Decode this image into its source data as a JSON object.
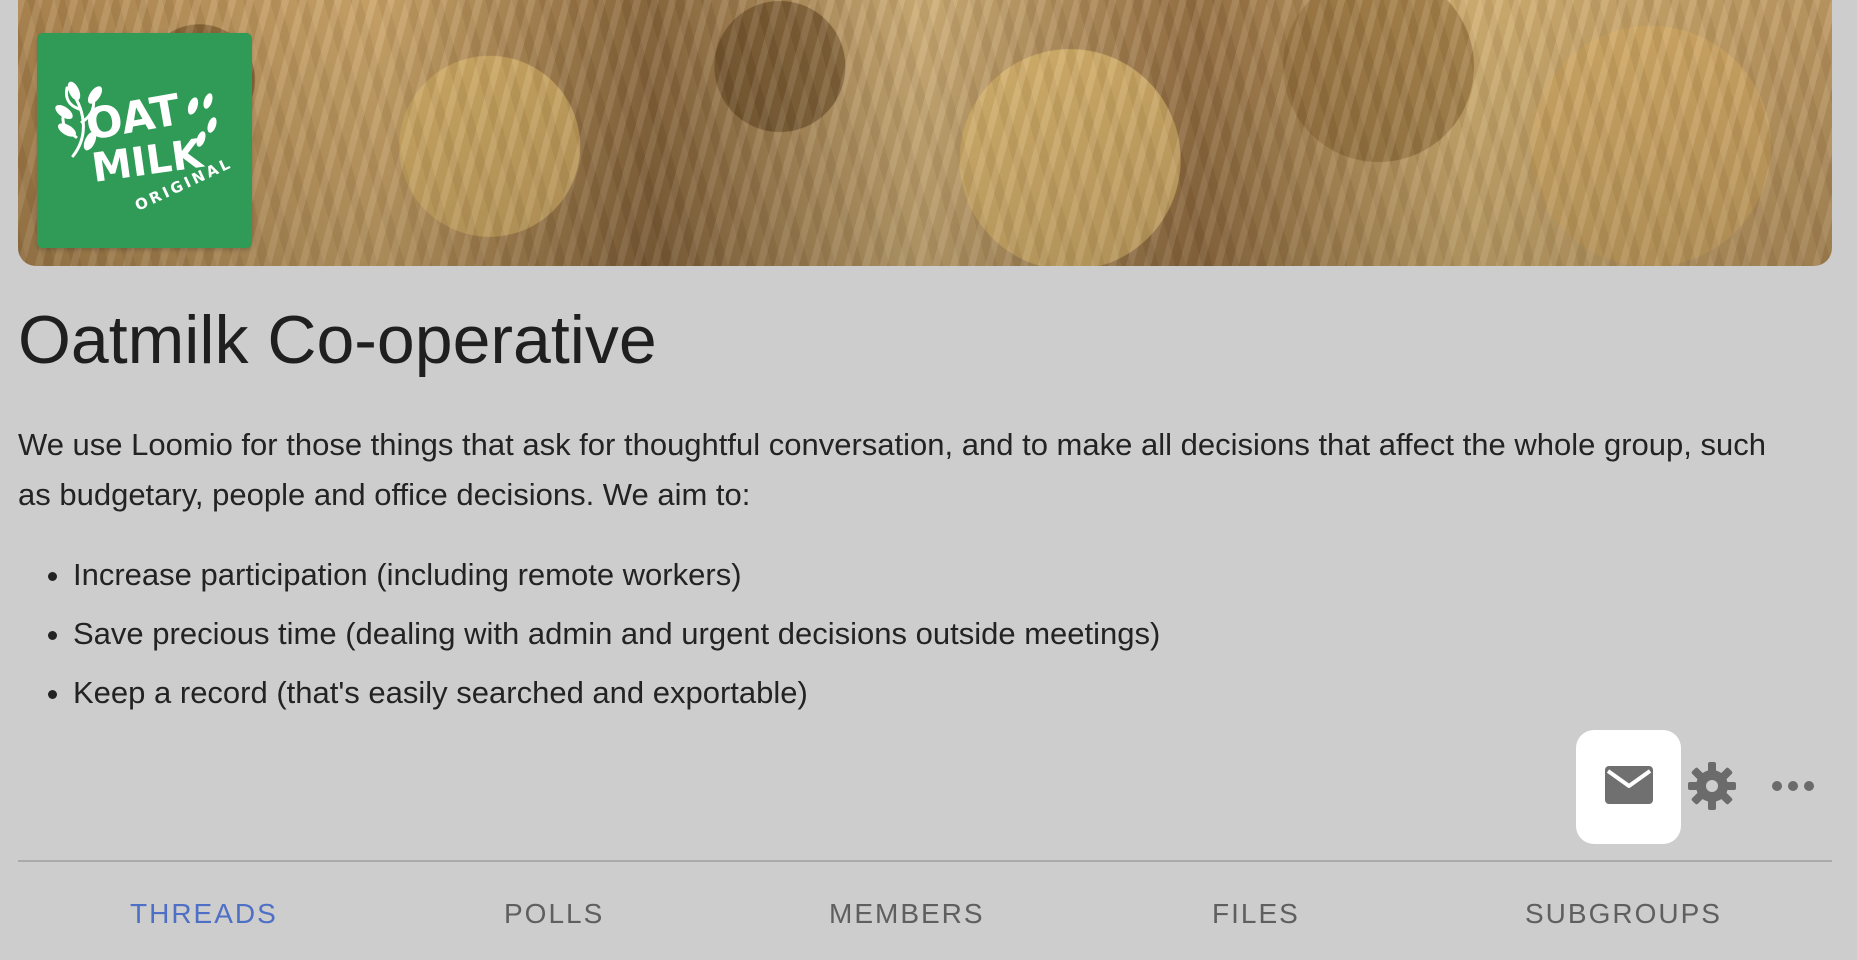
{
  "group": {
    "name": "Oatmilk Co-operative",
    "description": "We use Loomio for those things that ask for thoughtful conversation, and to make all decisions that affect the whole group, such as budgetary, people and office decisions. We aim to:",
    "aims": [
      "Increase participation (including remote workers)",
      "Save precious time (dealing with admin and urgent decisions outside meetings)",
      "Keep a record (that's easily searched and exportable)"
    ]
  },
  "logo": {
    "text": "OAT MILK ORIGINAL",
    "background": "#2f9b57",
    "foreground": "#ffffff"
  },
  "actions": [
    {
      "icon": "mail-icon"
    },
    {
      "icon": "gear-icon"
    },
    {
      "icon": "more-horizontal-icon"
    }
  ],
  "tabs": [
    {
      "label": "THREADS",
      "active": true
    },
    {
      "label": "POLLS",
      "active": false
    },
    {
      "label": "MEMBERS",
      "active": false
    },
    {
      "label": "FILES",
      "active": false
    },
    {
      "label": "SUBGROUPS",
      "active": false
    }
  ],
  "colors": {
    "page_background": "#cdcdcd",
    "active_tab": "#4e6fc6",
    "inactive_tab": "#5f5f5f",
    "icon": "#6b6b6b"
  }
}
